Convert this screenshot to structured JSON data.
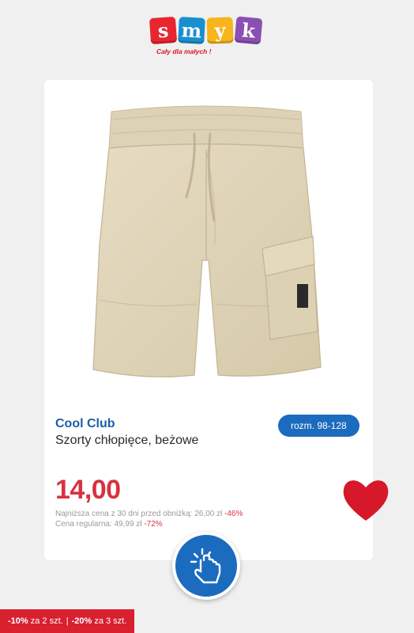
{
  "logo": {
    "letters": [
      "s",
      "m",
      "y",
      "k"
    ],
    "colors": [
      "#e8262f",
      "#1a8fd0",
      "#f7b41b",
      "#8a4fb2"
    ],
    "tagline": "Cały dla małych !"
  },
  "product": {
    "brand": "Cool Club",
    "name": "Szorty chłopięce, beżowe",
    "size": "rozm. 98-128",
    "price": "14,00",
    "lowest_price_label": "Najniższa cena z 30 dni przed obniżką: 26,00 zł",
    "lowest_price_discount": "-46%",
    "regular_price_label": "Cena regularna: 49,99 zł",
    "regular_price_discount": "-72%"
  },
  "promo": {
    "part1_bold": "-10%",
    "part1_text": "za 2 szt.",
    "separator": "|",
    "part2_bold": "-20%",
    "part2_text": "za 3 szt."
  },
  "colors": {
    "accent_blue": "#1b6bbf",
    "price_red": "#d7323f",
    "heart_red": "#d7182a",
    "background": "#f0f0f0"
  },
  "icons": {
    "heart": "heart-icon",
    "tap": "hand-tap-icon"
  }
}
